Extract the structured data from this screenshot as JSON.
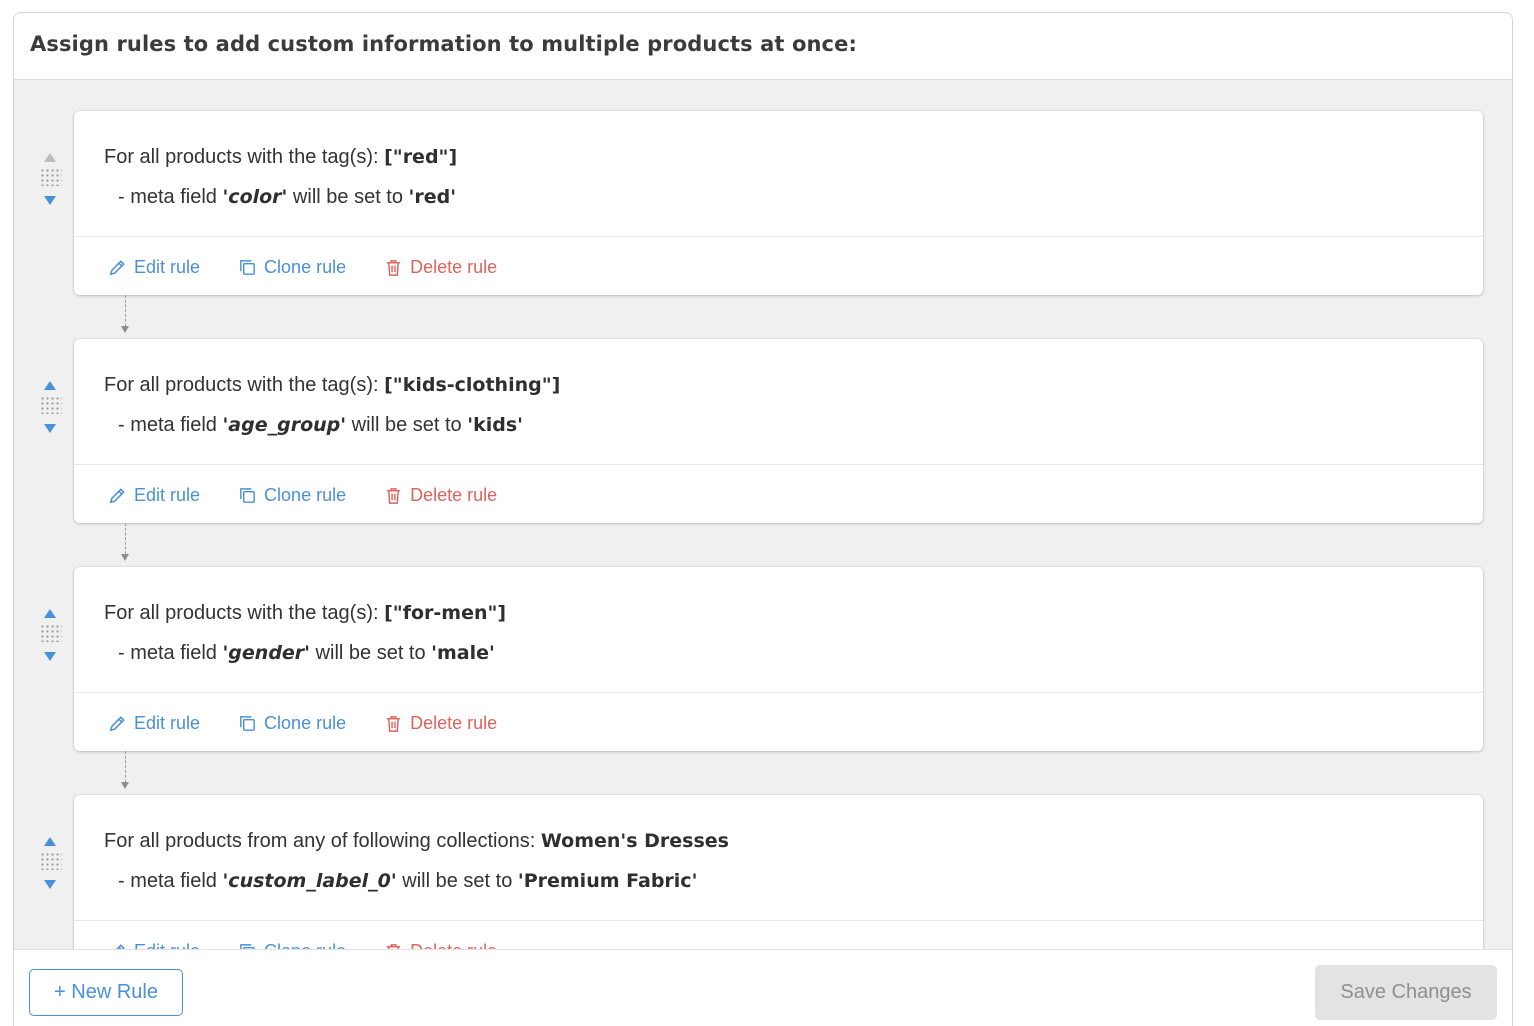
{
  "header": {
    "title": "Assign rules to add custom information to multiple products at once:"
  },
  "rules": [
    {
      "condition_prefix": "For all products with the tag(s): ",
      "condition_value": "[\"red\"]",
      "meta_prefix": "- meta field ",
      "field": "'color'",
      "mid": " will be set to ",
      "value": "'red'",
      "up_disabled": true
    },
    {
      "condition_prefix": "For all products with the tag(s): ",
      "condition_value": "[\"kids-clothing\"]",
      "meta_prefix": "- meta field ",
      "field": "'age_group'",
      "mid": " will be set to ",
      "value": "'kids'",
      "up_disabled": false
    },
    {
      "condition_prefix": "For all products with the tag(s): ",
      "condition_value": "[\"for-men\"]",
      "meta_prefix": "- meta field ",
      "field": "'gender'",
      "mid": " will be set to ",
      "value": "'male'",
      "up_disabled": false
    },
    {
      "condition_prefix": "For all products from any of following collections: ",
      "condition_value": "Women's Dresses",
      "meta_prefix": "- meta field ",
      "field": "'custom_label_0'",
      "mid": " will be set to ",
      "value": "'Premium Fabric'",
      "up_disabled": false
    }
  ],
  "actions": {
    "edit_label": "Edit rule",
    "clone_label": "Clone rule",
    "delete_label": "Delete rule"
  },
  "footer": {
    "new_rule_label": "+ New Rule",
    "save_label": "Save Changes"
  },
  "colors": {
    "accent": "#4a90d9",
    "danger": "#e0625c",
    "disabled": "#e3e3e3"
  }
}
